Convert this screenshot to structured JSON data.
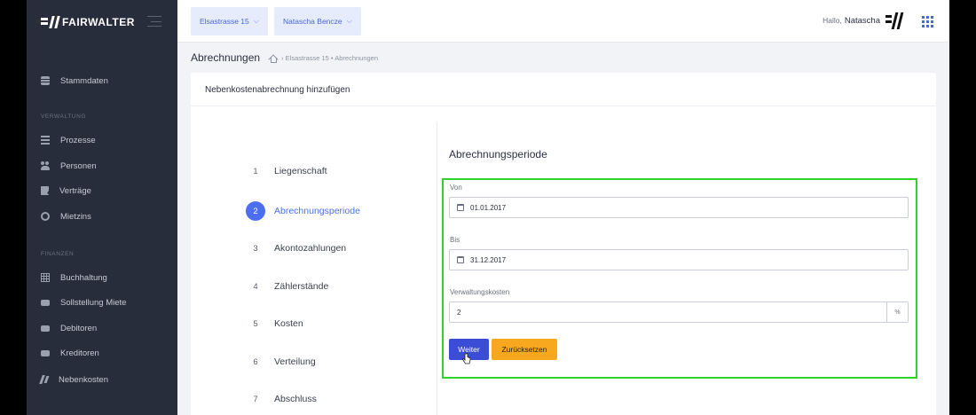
{
  "brand": {
    "name": "FAIRWALTER"
  },
  "sidebar": {
    "items": [
      {
        "label": "Stammdaten",
        "icon": "database-icon"
      },
      {
        "label": "Prozesse",
        "icon": "list-icon"
      },
      {
        "label": "Personen",
        "icon": "users-icon"
      },
      {
        "label": "Verträge",
        "icon": "contract-icon"
      },
      {
        "label": "Mietzins",
        "icon": "coins-icon"
      },
      {
        "label": "Buchhaltung",
        "icon": "ledger-icon"
      },
      {
        "label": "Sollstellung Miete",
        "icon": "money-icon"
      },
      {
        "label": "Debitoren",
        "icon": "money-icon"
      },
      {
        "label": "Kreditoren",
        "icon": "money-icon"
      },
      {
        "label": "Nebenkosten",
        "icon": "tools-icon"
      }
    ],
    "sections": {
      "verwaltung": "VERWALTUNG",
      "finanzen": "FINANZEN"
    }
  },
  "topbar": {
    "property_select": "Elsastrasse 15",
    "user_select": "Natascha Bencze",
    "greeting": "Hallo,",
    "user_name": "Natascha"
  },
  "breadcrumb": {
    "title": "Abrechnungen",
    "path": "› Elsastrasse 15 • Abrechnungen"
  },
  "card": {
    "title": "Nebenkostenabrechnung hinzufügen"
  },
  "steps": [
    {
      "num": "1",
      "label": "Liegenschaft"
    },
    {
      "num": "2",
      "label": "Abrechnungsperiode"
    },
    {
      "num": "3",
      "label": "Akontozahlungen"
    },
    {
      "num": "4",
      "label": "Zählerstände"
    },
    {
      "num": "5",
      "label": "Kosten"
    },
    {
      "num": "6",
      "label": "Verteilung"
    },
    {
      "num": "7",
      "label": "Abschluss"
    }
  ],
  "active_step": 2,
  "form": {
    "section_title": "Abrechnungsperiode",
    "von_label": "Von",
    "von_value": "01.01.2017",
    "bis_label": "Bis",
    "bis_value": "31.12.2017",
    "verwaltung_label": "Verwaltungskosten",
    "verwaltung_value": "2",
    "verwaltung_suffix": "%",
    "next_button": "Weiter",
    "reset_button": "Zurücksetzen"
  },
  "colors": {
    "accent": "#4c6ef0",
    "primary_button": "#3b4dd6",
    "reset_button": "#f7a81f",
    "highlight_box": "#31d12b",
    "sidebar_bg": "#272d3a"
  }
}
